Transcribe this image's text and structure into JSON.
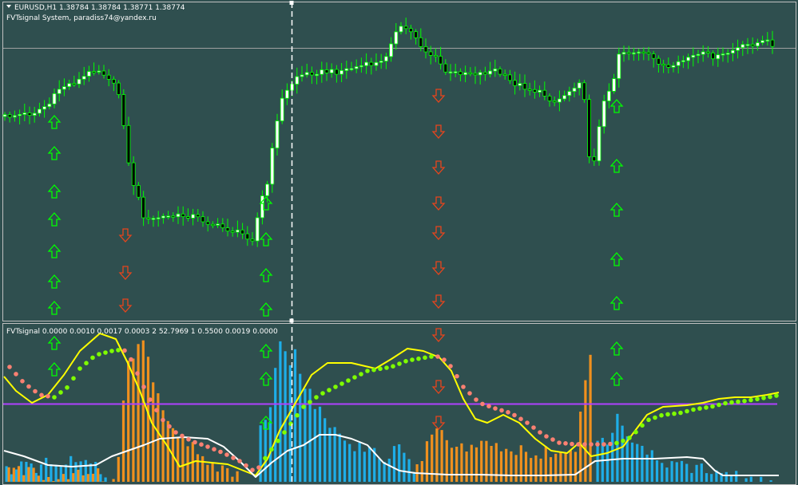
{
  "header": {
    "symbol_line": "EURUSD,H1  1.38784 1.38784 1.38771 1.38774",
    "indicator_line": "FVTsignal System, paradiss74@yandex.ru"
  },
  "subwindow": {
    "title": "FVTsignal 0.0000 0.0010 0.0017 0.0003  2 52.7969  1 0.5500 0.0019 0.0000"
  },
  "colors": {
    "background": "#2f4f4f",
    "border": "#c0c0c0",
    "bull_body": "#ffffff",
    "bear_body": "#000000",
    "wick": "#00ff00",
    "arrow_up": "#00ff00",
    "arrow_down": "#e8451c",
    "hist_up": "#1eaee8",
    "hist_down": "#f0901e",
    "signal_line": "#ffff00",
    "base_line": "#ffffff",
    "dot_up": "#7fff00",
    "dot_down": "#fa8072",
    "level_line": "#b040ff",
    "price_line": "#a0a0a0"
  },
  "icons": {
    "menu": "triangle-down-icon",
    "up_arrow": "up-arrow-icon",
    "down_arrow": "down-arrow-icon"
  }
}
